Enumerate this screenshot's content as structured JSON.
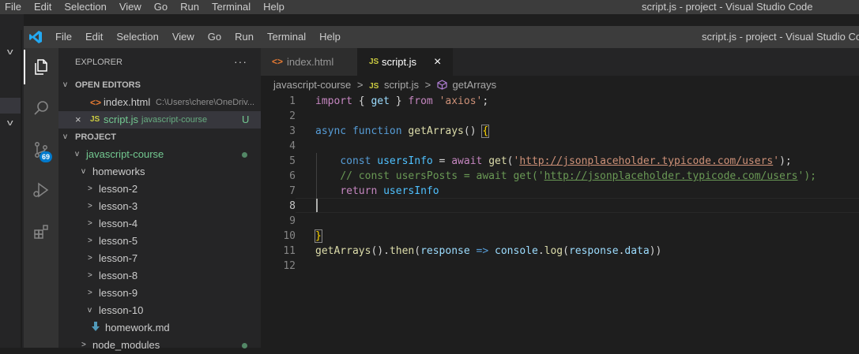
{
  "outer_window": {
    "menu": [
      "File",
      "Edit",
      "Selection",
      "View",
      "Go",
      "Run",
      "Terminal",
      "Help"
    ],
    "title": "script.js - project - Visual Studio Code"
  },
  "inner_window": {
    "menu": [
      "File",
      "Edit",
      "Selection",
      "View",
      "Go",
      "Run",
      "Terminal",
      "Help"
    ],
    "title": "script.js - project - Visual Studio Code"
  },
  "activity_bar": {
    "items": [
      {
        "name": "explorer",
        "icon": "files-icon",
        "active": true
      },
      {
        "name": "search",
        "icon": "search-icon"
      },
      {
        "name": "source-control",
        "icon": "source-control-icon",
        "badge": "69"
      },
      {
        "name": "run-debug",
        "icon": "debug-icon"
      },
      {
        "name": "extensions",
        "icon": "extensions-icon"
      }
    ]
  },
  "sidebar": {
    "title": "EXPLORER",
    "more": "···",
    "open_editors": {
      "label": "OPEN EDITORS",
      "items": [
        {
          "name": "index.html",
          "path": "C:\\Users\\chere\\OneDriv...",
          "icon": "<>"
        },
        {
          "name": "script.js",
          "path": "javascript-course",
          "icon": "JS",
          "status": "U",
          "close": "×"
        }
      ]
    },
    "project": {
      "label": "PROJECT",
      "tree": [
        {
          "label": "javascript-course",
          "chevron": "v"
        },
        {
          "label": "homeworks",
          "chevron": "v"
        },
        {
          "label": "lesson-2",
          "chevron": ">"
        },
        {
          "label": "lesson-3",
          "chevron": ">"
        },
        {
          "label": "lesson-4",
          "chevron": ">"
        },
        {
          "label": "lesson-5",
          "chevron": ">"
        },
        {
          "label": "lesson-7",
          "chevron": ">"
        },
        {
          "label": "lesson-8",
          "chevron": ">"
        },
        {
          "label": "lesson-9",
          "chevron": ">"
        },
        {
          "label": "lesson-10",
          "chevron": "v"
        },
        {
          "label": "homework.md",
          "icon": "markdown-icon"
        },
        {
          "label": "node_modules",
          "chevron": ">"
        }
      ]
    }
  },
  "tabs": [
    {
      "label": "index.html",
      "icon": "<>"
    },
    {
      "label": "script.js",
      "icon": "JS",
      "close": "×",
      "active": true
    }
  ],
  "breadcrumb": {
    "folder": "javascript-course",
    "sep": ">",
    "file_icon": "JS",
    "file": "script.js",
    "symbol": "getArrays"
  },
  "editor": {
    "line_numbers": [
      "1",
      "2",
      "3",
      "4",
      "5",
      "6",
      "7",
      "8",
      "9",
      "10",
      "11",
      "12"
    ],
    "code": {
      "l1": {
        "kw": "import",
        "b1": " { ",
        "v": "get",
        "b2": " } ",
        "kw2": "from",
        "sp": " ",
        "s": "'axios'",
        "end": ";"
      },
      "l3": {
        "kw": "async",
        "sp": " ",
        "kw2": "function",
        "sp2": " ",
        "fn": "getArrays",
        "p": "() ",
        "br": "{"
      },
      "l5": {
        "ind": "    ",
        "kw": "const",
        "sp": " ",
        "v": "usersInfo",
        "eq": " = ",
        "ctl": "await",
        "sp2": " ",
        "fn": "get",
        "o": "(",
        "q1": "'",
        "u": "http://jsonplaceholder.typicode.com/users",
        "q2": "'",
        "e": ");"
      },
      "l6": {
        "ind": "    ",
        "c1": "// const usersPosts = await get('",
        "u": "http://jsonplaceholder.typicode.com/users",
        "c2": "');"
      },
      "l7": {
        "ind": "    ",
        "ctl": "return",
        "sp": " ",
        "v": "usersInfo"
      },
      "l10": {
        "br": "}"
      },
      "l11": {
        "fn": "getArrays",
        "p1": "().",
        "fn2": "then",
        "p2": "(",
        "v": "response",
        "ar": " => ",
        "v2": "console",
        "d": ".",
        "fn3": "log",
        "p3": "(",
        "v3": "response",
        "d2": ".",
        "v4": "data",
        "e": "))"
      }
    }
  },
  "colors": {
    "accent": "#007acc",
    "js_icon": "#cbcb41",
    "html_icon": "#e37933",
    "untracked": "#73c991"
  }
}
